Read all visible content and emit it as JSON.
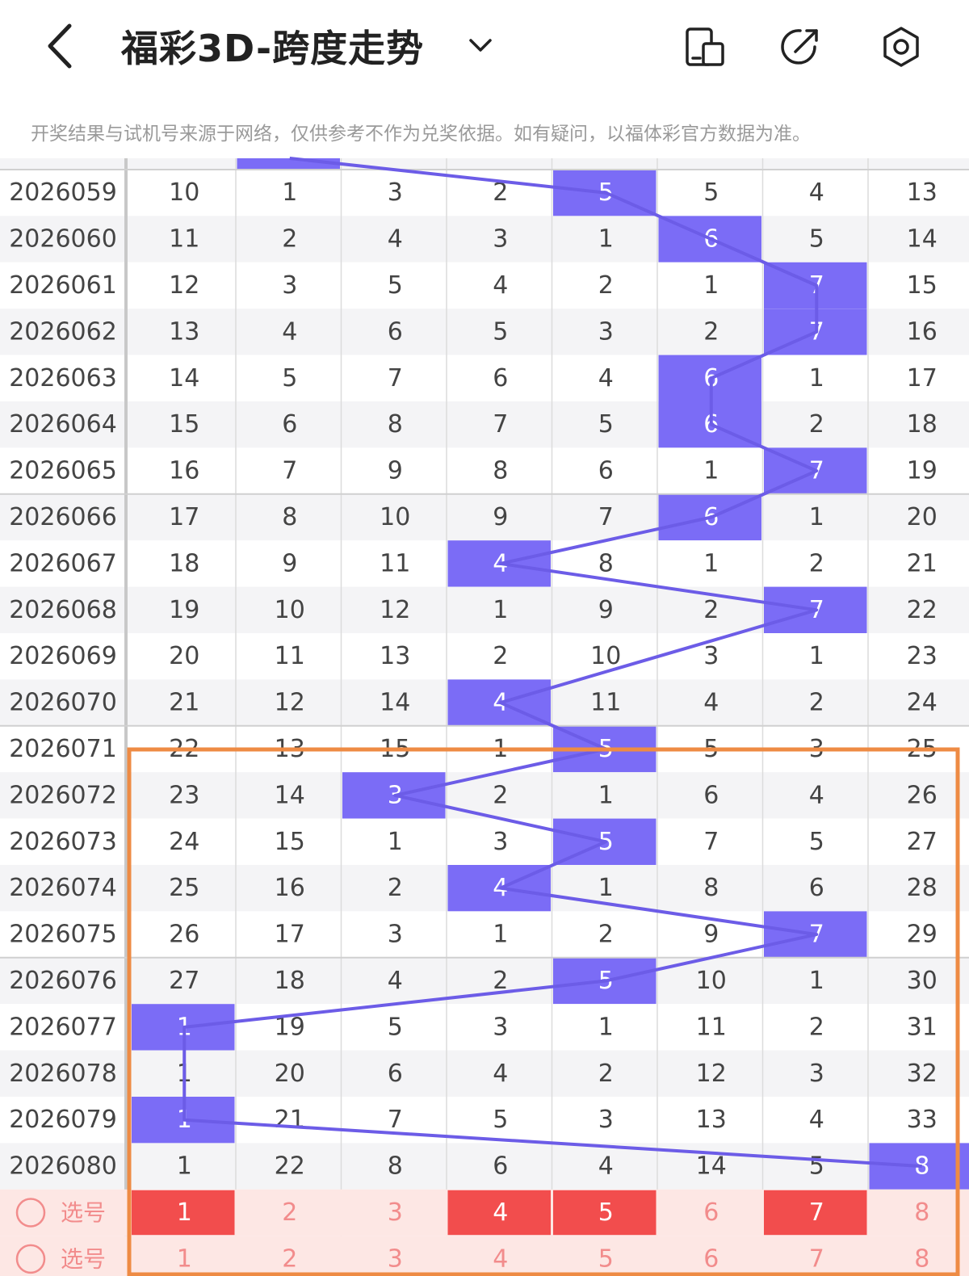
{
  "header": {
    "title": "福彩3D-跨度走势",
    "notice": "开奖结果与试机号来源于网络，仅供参考不作为兑奖依据。如有疑问，以福体彩官方数据为准。"
  },
  "icons": {
    "back": "chevron-left-icon",
    "dropdown": "chevron-down-icon",
    "phone": "phone-layout-icon",
    "share": "share-icon",
    "settings": "settings-icon"
  },
  "colors": {
    "highlight": "#7b6cf6",
    "line": "#6c5ce7",
    "select_bg": "#fde7e4",
    "select_active": "#f24d4d",
    "select_text": "#f28c8c",
    "orange_box": "#ee8b44"
  },
  "partial_top_hits": [
    1
  ],
  "rows": [
    {
      "period": "2026059",
      "cells": [
        "10",
        "1",
        "3",
        "2",
        "5",
        "5",
        "4",
        "13"
      ],
      "hit": 4
    },
    {
      "period": "2026060",
      "cells": [
        "11",
        "2",
        "4",
        "3",
        "1",
        "6",
        "5",
        "14"
      ],
      "hit": 5
    },
    {
      "period": "2026061",
      "cells": [
        "12",
        "3",
        "5",
        "4",
        "2",
        "1",
        "7",
        "15"
      ],
      "hit": 6
    },
    {
      "period": "2026062",
      "cells": [
        "13",
        "4",
        "6",
        "5",
        "3",
        "2",
        "7",
        "16"
      ],
      "hit": 6
    },
    {
      "period": "2026063",
      "cells": [
        "14",
        "5",
        "7",
        "6",
        "4",
        "6",
        "1",
        "17"
      ],
      "hit": 5
    },
    {
      "period": "2026064",
      "cells": [
        "15",
        "6",
        "8",
        "7",
        "5",
        "6",
        "2",
        "18"
      ],
      "hit": 5
    },
    {
      "period": "2026065",
      "cells": [
        "16",
        "7",
        "9",
        "8",
        "6",
        "1",
        "7",
        "19"
      ],
      "hit": 6
    },
    {
      "period": "2026066",
      "cells": [
        "17",
        "8",
        "10",
        "9",
        "7",
        "6",
        "1",
        "20"
      ],
      "hit": 5
    },
    {
      "period": "2026067",
      "cells": [
        "18",
        "9",
        "11",
        "4",
        "8",
        "1",
        "2",
        "21"
      ],
      "hit": 3
    },
    {
      "period": "2026068",
      "cells": [
        "19",
        "10",
        "12",
        "1",
        "9",
        "2",
        "7",
        "22"
      ],
      "hit": 6
    },
    {
      "period": "2026069",
      "cells": [
        "20",
        "11",
        "13",
        "2",
        "10",
        "3",
        "1",
        "23"
      ],
      "hit": 8
    },
    {
      "period": "2026070",
      "cells": [
        "21",
        "12",
        "14",
        "4",
        "11",
        "4",
        "2",
        "24"
      ],
      "hit": 3
    },
    {
      "period": "2026071",
      "cells": [
        "22",
        "13",
        "15",
        "1",
        "5",
        "5",
        "3",
        "25"
      ],
      "hit": 4
    },
    {
      "period": "2026072",
      "cells": [
        "23",
        "14",
        "3",
        "2",
        "1",
        "6",
        "4",
        "26"
      ],
      "hit": 2
    },
    {
      "period": "2026073",
      "cells": [
        "24",
        "15",
        "1",
        "3",
        "5",
        "7",
        "5",
        "27"
      ],
      "hit": 4
    },
    {
      "period": "2026074",
      "cells": [
        "25",
        "16",
        "2",
        "4",
        "1",
        "8",
        "6",
        "28"
      ],
      "hit": 3
    },
    {
      "period": "2026075",
      "cells": [
        "26",
        "17",
        "3",
        "1",
        "2",
        "9",
        "7",
        "29"
      ],
      "hit": 6
    },
    {
      "period": "2026076",
      "cells": [
        "27",
        "18",
        "4",
        "2",
        "5",
        "10",
        "1",
        "30"
      ],
      "hit": 4
    },
    {
      "period": "2026077",
      "cells": [
        "1",
        "19",
        "5",
        "3",
        "1",
        "11",
        "2",
        "31"
      ],
      "hit": 0
    },
    {
      "period": "2026078",
      "cells": [
        "1",
        "20",
        "6",
        "4",
        "2",
        "12",
        "3",
        "32"
      ],
      "hit": 8
    },
    {
      "period": "2026079",
      "cells": [
        "1",
        "21",
        "7",
        "5",
        "3",
        "13",
        "4",
        "33"
      ],
      "hit": 0
    },
    {
      "period": "2026080",
      "cells": [
        "1",
        "22",
        "8",
        "6",
        "4",
        "14",
        "5",
        "8"
      ],
      "hit": 7
    }
  ],
  "select_rows": [
    {
      "label": "选号",
      "cells": [
        "1",
        "2",
        "3",
        "4",
        "5",
        "6",
        "7",
        "8"
      ],
      "active": [
        0,
        3,
        4,
        6
      ]
    },
    {
      "label": "选号",
      "cells": [
        "1",
        "2",
        "3",
        "4",
        "5",
        "6",
        "7",
        "8"
      ],
      "active": []
    }
  ]
}
